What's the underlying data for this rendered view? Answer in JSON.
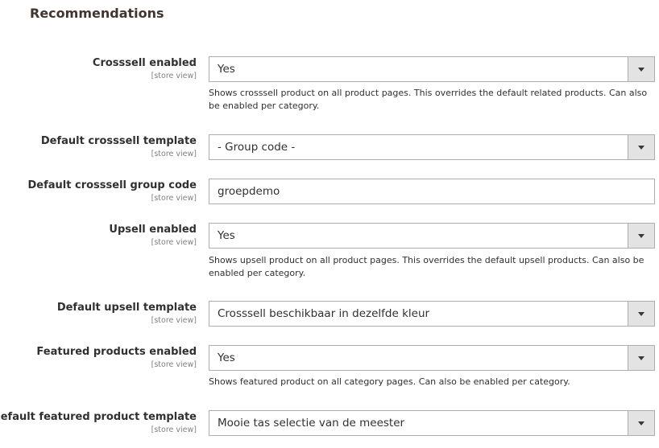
{
  "section": {
    "title": "Recommendations"
  },
  "fields": [
    {
      "label": "Crosssell enabled",
      "scope": "[store view]",
      "value": "Yes",
      "note": "Shows crosssell product on all product pages. This overrides the default related products. Can also be enabled per category."
    },
    {
      "label": "Default crosssell template",
      "scope": "[store view]",
      "value": "- Group code -"
    },
    {
      "label": "Default crosssell group code",
      "scope": "[store view]",
      "value": "groepdemo"
    },
    {
      "label": "Upsell enabled",
      "scope": "[store view]",
      "value": "Yes",
      "note": "Shows upsell product on all product pages. This overrides the default upsell products. Can also be enabled per category."
    },
    {
      "label": "Default upsell template",
      "scope": "[store view]",
      "value": "Crosssell beschikbaar in dezelfde kleur"
    },
    {
      "label": "Featured products enabled",
      "scope": "[store view]",
      "value": "Yes",
      "note": "Shows featured product on all category pages. Can also be enabled per category."
    },
    {
      "label": "Default featured product template",
      "scope": "[store view]",
      "value": "Mooie tas selectie van de meester"
    }
  ],
  "icons": {
    "dropdown": "chevron-down-icon"
  }
}
